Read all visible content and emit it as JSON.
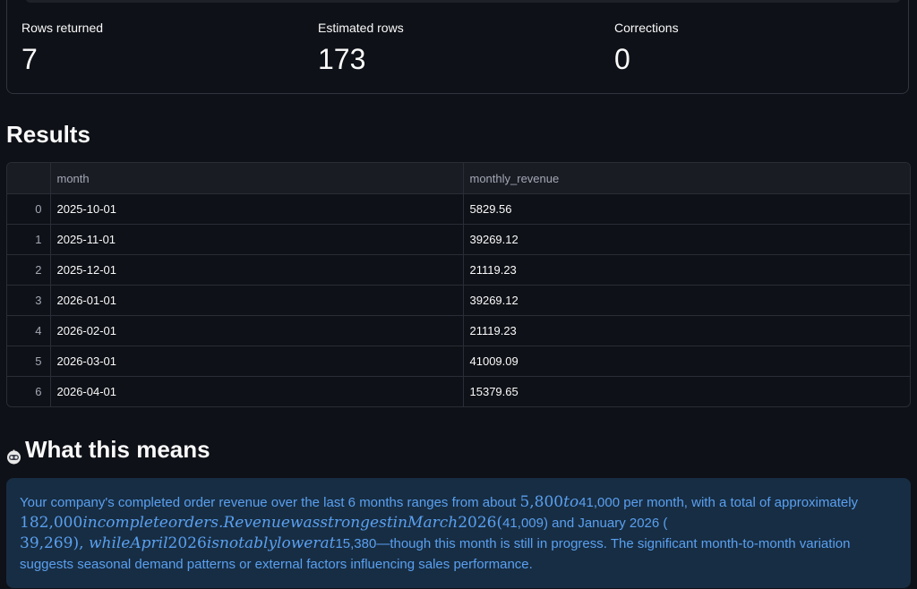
{
  "metrics": [
    {
      "label": "Rows returned",
      "value": "7"
    },
    {
      "label": "Estimated rows",
      "value": "173"
    },
    {
      "label": "Corrections",
      "value": "0"
    }
  ],
  "results": {
    "heading": "Results",
    "columns": [
      "month",
      "monthly_revenue"
    ],
    "rows": [
      {
        "index": "0",
        "month": "2025-10-01",
        "monthly_revenue": "5829.56"
      },
      {
        "index": "1",
        "month": "2025-11-01",
        "monthly_revenue": "39269.12"
      },
      {
        "index": "2",
        "month": "2025-12-01",
        "monthly_revenue": "21119.23"
      },
      {
        "index": "3",
        "month": "2026-01-01",
        "monthly_revenue": "39269.12"
      },
      {
        "index": "4",
        "month": "2026-02-01",
        "monthly_revenue": "21119.23"
      },
      {
        "index": "5",
        "month": "2026-03-01",
        "monthly_revenue": "41009.09"
      },
      {
        "index": "6",
        "month": "2026-04-01",
        "monthly_revenue": "15379.65"
      }
    ]
  },
  "insight": {
    "heading": "What this means",
    "icon": "robot-icon",
    "seg1": "Your company's completed order revenue over the last 6 months ranges from about ",
    "math1": "5,800",
    "math1b": "to",
    "seg2": "41,000 per month, with a total of approximately",
    "math2": "182,000",
    "math2b": "incompleteorders.RevenuewasstrongestinMarch",
    "math2c": "2026(",
    "seg3": "41,009) and January 2026 (",
    "math3": "39,269),",
    "math3b": "whileApril",
    "math3c": "2026",
    "math3d": "isnotablylowerat",
    "seg4": "15,380—though this month is still in progress. The significant month-to-month variation suggests seasonal demand patterns or external factors influencing sales performance."
  },
  "colors": {
    "background": "#0e1117",
    "info_bg": "#172d43",
    "info_text": "#5aa0f0"
  }
}
